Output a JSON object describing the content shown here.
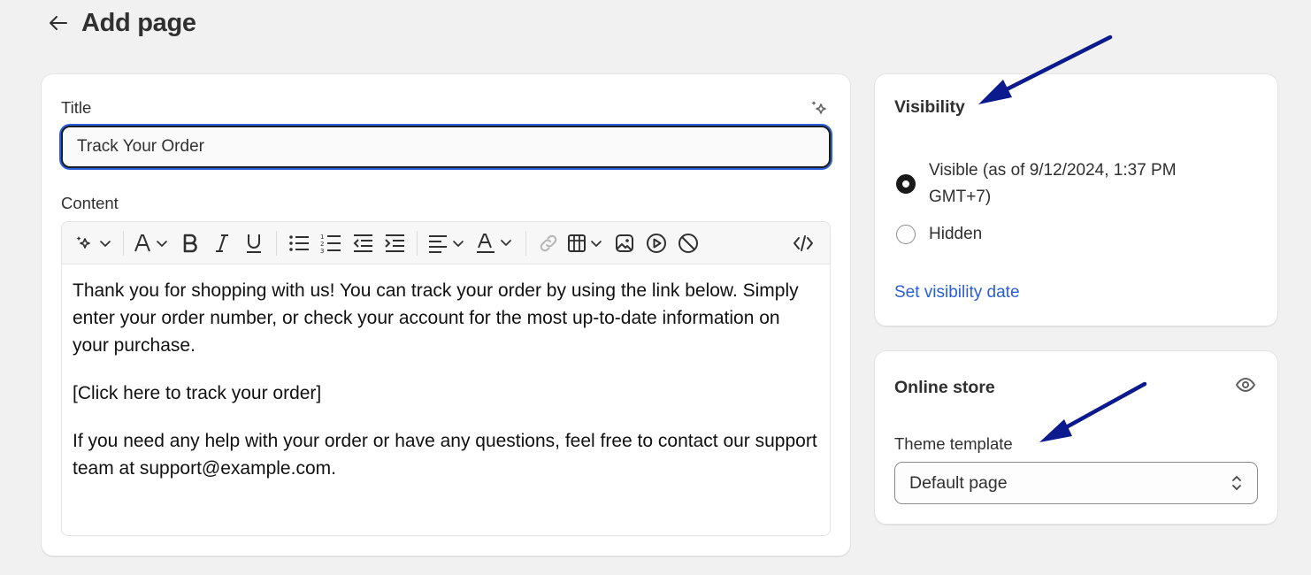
{
  "header": {
    "title": "Add page",
    "back_icon": "arrow-left-icon"
  },
  "main": {
    "title_label": "Title",
    "title_value": "Track Your Order",
    "content_label": "Content",
    "toolbar_icons": [
      "magic-icon",
      "text-style-icon",
      "bold-icon",
      "italic-icon",
      "underline-icon",
      "bulleted-list-icon",
      "numbered-list-icon",
      "outdent-icon",
      "indent-icon",
      "align-icon",
      "text-color-icon",
      "link-icon",
      "table-icon",
      "image-icon",
      "video-icon",
      "clear-formatting-icon",
      "code-icon"
    ],
    "content": [
      "Thank you for shopping with us! You can track your order by using the link below. Simply enter your order number, or check your account for the most up-to-date information on your purchase.",
      "[Click here to track your order]",
      "If you need any help with your order or have any questions, feel free to contact our support team at support@example.com."
    ]
  },
  "visibility": {
    "title": "Visibility",
    "options": [
      {
        "label": "Visible (as of 9/12/2024, 1:37 PM GMT+7)",
        "selected": true
      },
      {
        "label": "Hidden",
        "selected": false
      }
    ],
    "set_date_link": "Set visibility date"
  },
  "online_store": {
    "title": "Online store",
    "template_label": "Theme template",
    "template_value": "Default page"
  },
  "colors": {
    "accent": "#2b5ed8",
    "annotation_arrow": "#0b1a8c",
    "background": "#f1f1f1"
  }
}
